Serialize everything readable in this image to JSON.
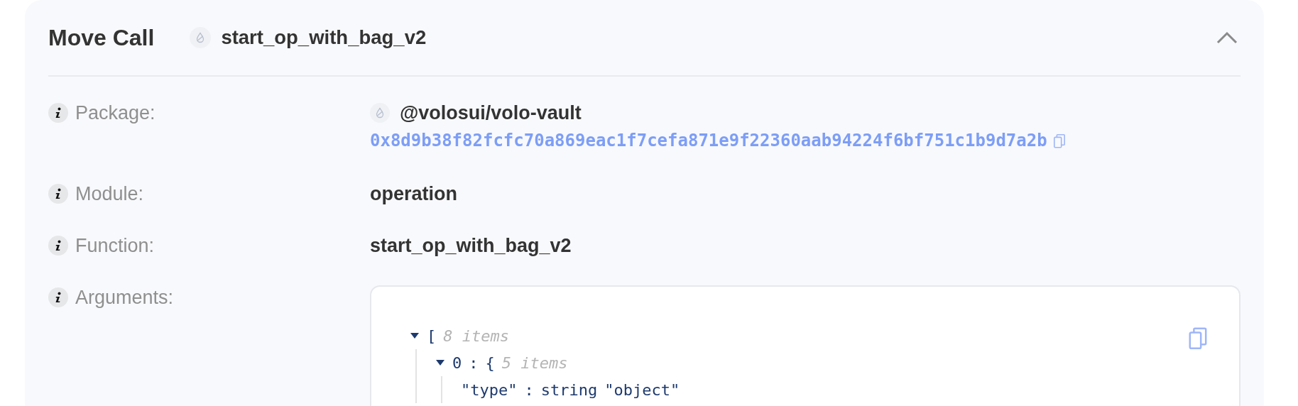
{
  "card": {
    "title": "Move Call",
    "function_name": "start_op_with_bag_v2",
    "expanded": true
  },
  "fields": [
    {
      "kind": "package",
      "label": "Package:",
      "name": "@volosui/volo-vault",
      "address": "0x8d9b38f82fcfc70a869eac1f7cefa871e9f22360aab94224f6bf751c1b9d7a2b"
    },
    {
      "kind": "text",
      "label": "Module:",
      "value": "operation"
    },
    {
      "kind": "text",
      "label": "Function:",
      "value": "start_op_with_bag_v2"
    },
    {
      "kind": "json",
      "label": "Arguments:"
    }
  ],
  "arguments": {
    "separator": ":",
    "tree": {
      "kind": "array",
      "bracket": "[",
      "count": "8 items",
      "expanded": true,
      "children": [
        {
          "kind": "object",
          "key": "0",
          "bracket": "{",
          "count": "5 items",
          "expanded": true,
          "children": [
            {
              "kind": "value",
              "key": "\"type\"",
              "type": "string",
              "value": "\"object\""
            }
          ]
        }
      ]
    }
  }
}
